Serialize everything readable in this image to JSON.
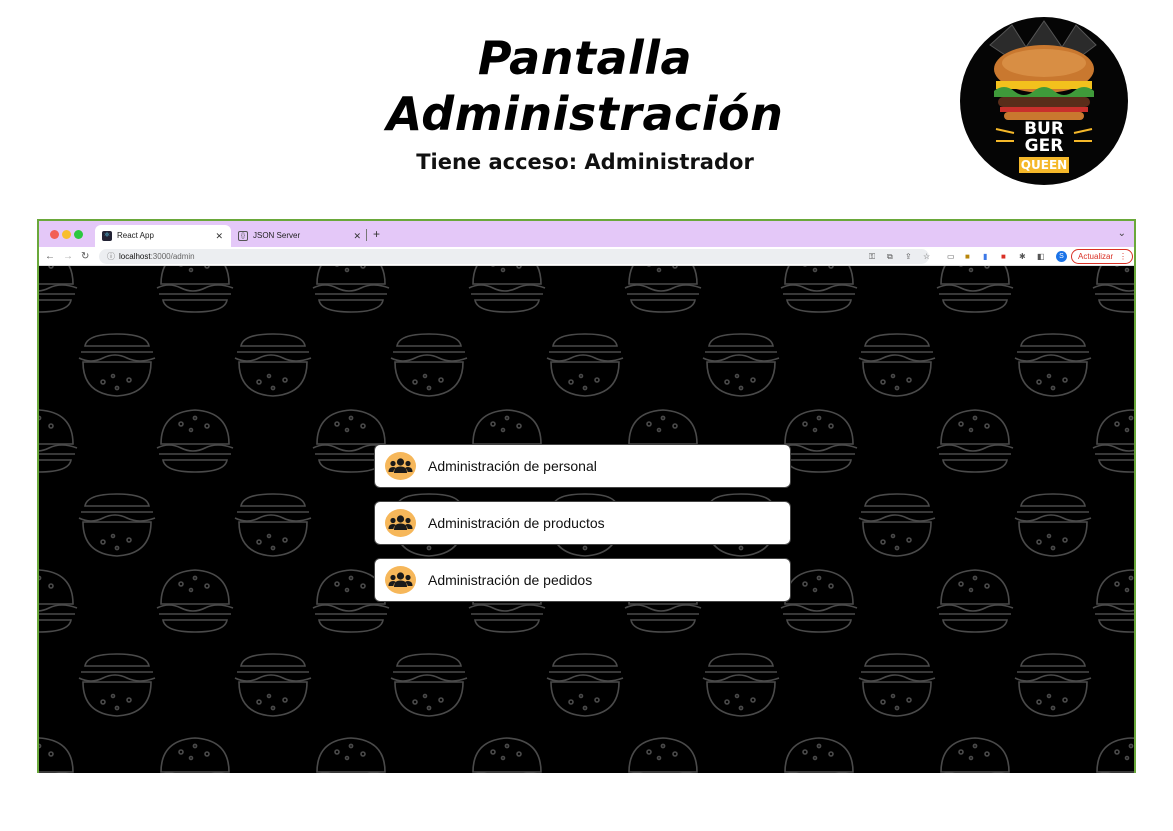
{
  "slide": {
    "title_line1": "Pantalla",
    "title_line2": "Administración",
    "subtitle": "Tiene acceso: Administrador"
  },
  "logo": {
    "line1": "BUR",
    "line2": "GER",
    "line3": "QUEEN"
  },
  "browser": {
    "tabs": [
      {
        "label": "React App",
        "favicon": "react-icon"
      },
      {
        "label": "JSON Server",
        "favicon": "json-icon"
      }
    ],
    "address": {
      "host": "localhost",
      "path": ":3000/admin"
    },
    "profile_initial": "S",
    "update_label": "Actualizar"
  },
  "menu": {
    "items": [
      {
        "label": "Administración de personal",
        "icon": "users-icon"
      },
      {
        "label": "Administración de productos",
        "icon": "users-icon"
      },
      {
        "label": "Administración de pedidos",
        "icon": "users-icon"
      }
    ]
  },
  "colors": {
    "tabbar": "#e4c8f8",
    "icon_badge": "#f6b75a",
    "window_border": "#6aa83a",
    "background": "#000000",
    "update_button": "#d93025"
  }
}
